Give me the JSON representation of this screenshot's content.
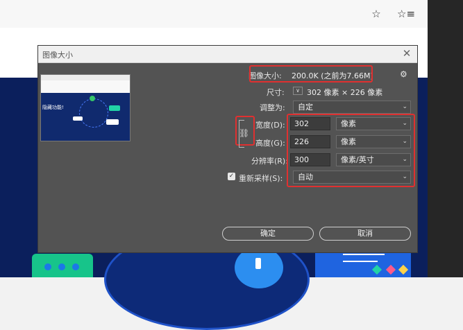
{
  "browser": {
    "favorite_icon": "star-plus-icon",
    "favorites_list_icon": "favorites-list-icon"
  },
  "dialog": {
    "title": "图像大小",
    "close": "✕",
    "image_size_label": "图像大小:",
    "image_size_value": "200.0K (之前为7.66M)",
    "gear": "⚙",
    "dimensions_label": "尺寸:",
    "dimensions_value": "302 像素  ×  226 像素",
    "fit_to_label": "调整为:",
    "fit_to_value": "自定",
    "width_label": "宽度(D):",
    "width_value": "302",
    "width_unit": "像素",
    "height_label": "高度(G):",
    "height_value": "226",
    "height_unit": "像素",
    "resolution_label": "分辨率(R):",
    "resolution_value": "300",
    "resolution_unit": "像素/英寸",
    "resample_label": "重新采样(S):",
    "resample_checked": true,
    "resample_value": "自动",
    "ok_label": "确定",
    "cancel_label": "取消",
    "preview_text": "隐藏功能!"
  },
  "colors": {
    "highlight": "#e03030",
    "dialog_bg": "#535353",
    "page_bg": "#0b1f5c"
  }
}
